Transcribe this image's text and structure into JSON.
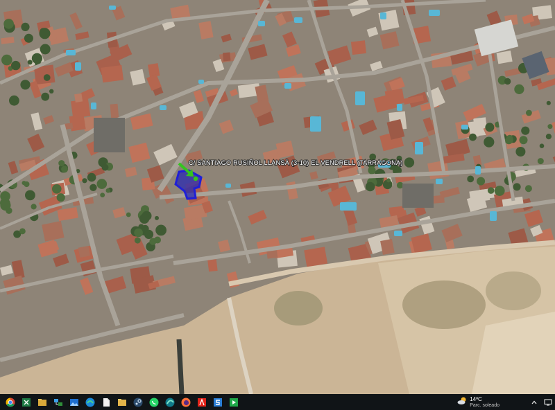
{
  "map": {
    "location_label": "C/ SANTIAGO RUSIÑOL LLANSÀ (3-10) EL VENDRELL (TARRAGONA)",
    "marker": "green-arrow-pin-icon",
    "parcel_outline_color": "#1f1fd6",
    "parcel_fill_color": "#2a2ab0",
    "marker_color": "#35c41f"
  },
  "taskbar": {
    "apps": [
      "chrome-icon",
      "excel-icon",
      "file-explorer-icon",
      "network-icon",
      "photos-icon",
      "edge-icon",
      "document-icon",
      "folder-icon",
      "steam-icon",
      "whatsapp-icon",
      "edge-alt-icon",
      "firefox-icon",
      "acrobat-icon",
      "s-app-icon",
      "green-app-icon"
    ],
    "weather": {
      "temperature": "14ºC",
      "condition": "Parc. soleado"
    }
  }
}
